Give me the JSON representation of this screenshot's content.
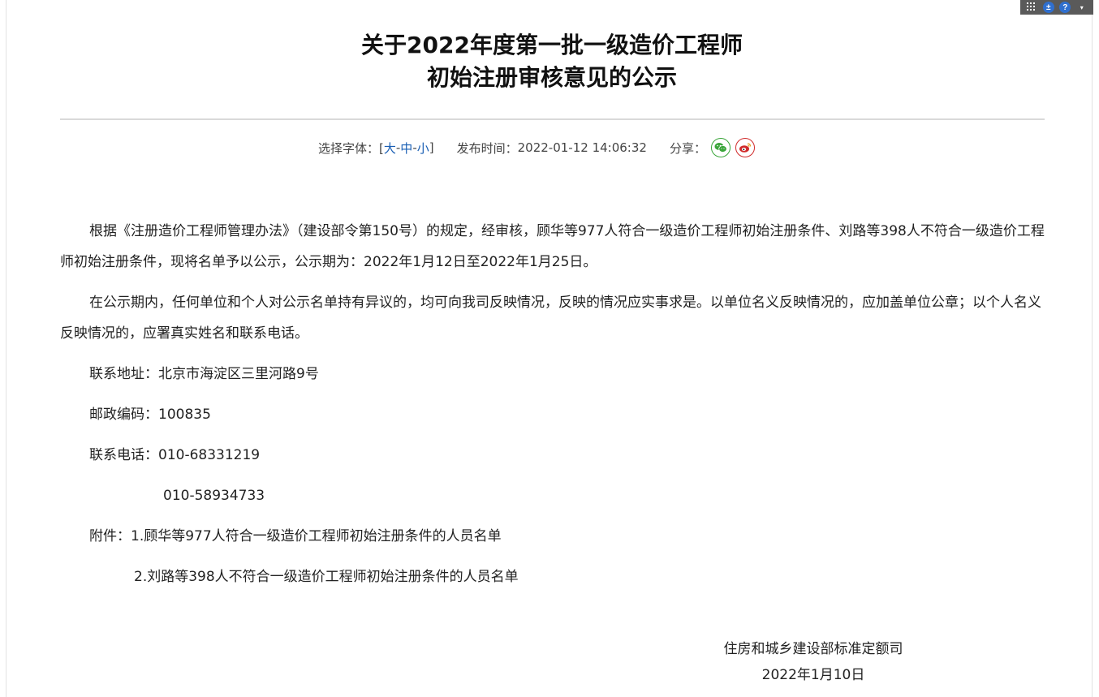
{
  "toolbar": {
    "icons": [
      "grid-icon",
      "accessibility-icon",
      "help-icon",
      "caret-down-icon"
    ],
    "accessibility_glyph": "±",
    "help_glyph": "?",
    "caret_glyph": "▾"
  },
  "title": {
    "line1": "关于2022年度第一批一级造价工程师",
    "line2": "初始注册审核意见的公示"
  },
  "meta": {
    "font_label": "选择字体：[",
    "font_large": "大",
    "font_sep1": " - ",
    "font_medium": "中",
    "font_sep2": " - ",
    "font_small": "小",
    "font_close": "]",
    "publish_label": "发布时间：",
    "publish_time": "2022-01-12 14:06:32",
    "share_label": "分享：",
    "share_icons": [
      "wechat-icon",
      "weibo-icon"
    ]
  },
  "content": {
    "para1": "根据《注册造价工程师管理办法》（建设部令第150号）的规定，经审核，顾华等977人符合一级造价工程师初始注册条件、刘路等398人不符合一级造价工程师初始注册条件，现将名单予以公示，公示期为：2022年1月12日至2022年1月25日。",
    "para2": "在公示期内，任何单位和个人对公示名单持有异议的，均可向我司反映情况，反映的情况应实事求是。以单位名义反映情况的，应加盖单位公章；以个人名义反映情况的，应署真实姓名和联系电话。",
    "address": "联系地址：北京市海淀区三里河路9号",
    "postcode": "邮政编码：100835",
    "phone1": "联系电话：010-68331219",
    "phone2": "010-58934733",
    "attachment1": "附件：1.顾华等977人符合一级造价工程师初始注册条件的人员名单",
    "attachment2": "2.刘路等398人不符合一级造价工程师初始注册条件的人员名单"
  },
  "signature": {
    "org": "住房和城乡建设部标准定额司",
    "date": "2022年1月10日"
  },
  "colors": {
    "link": "#1a5fb4",
    "wechat": "#3aa53a",
    "weibo": "#d02a2a",
    "toolbar_bg": "#5a5a5a"
  }
}
